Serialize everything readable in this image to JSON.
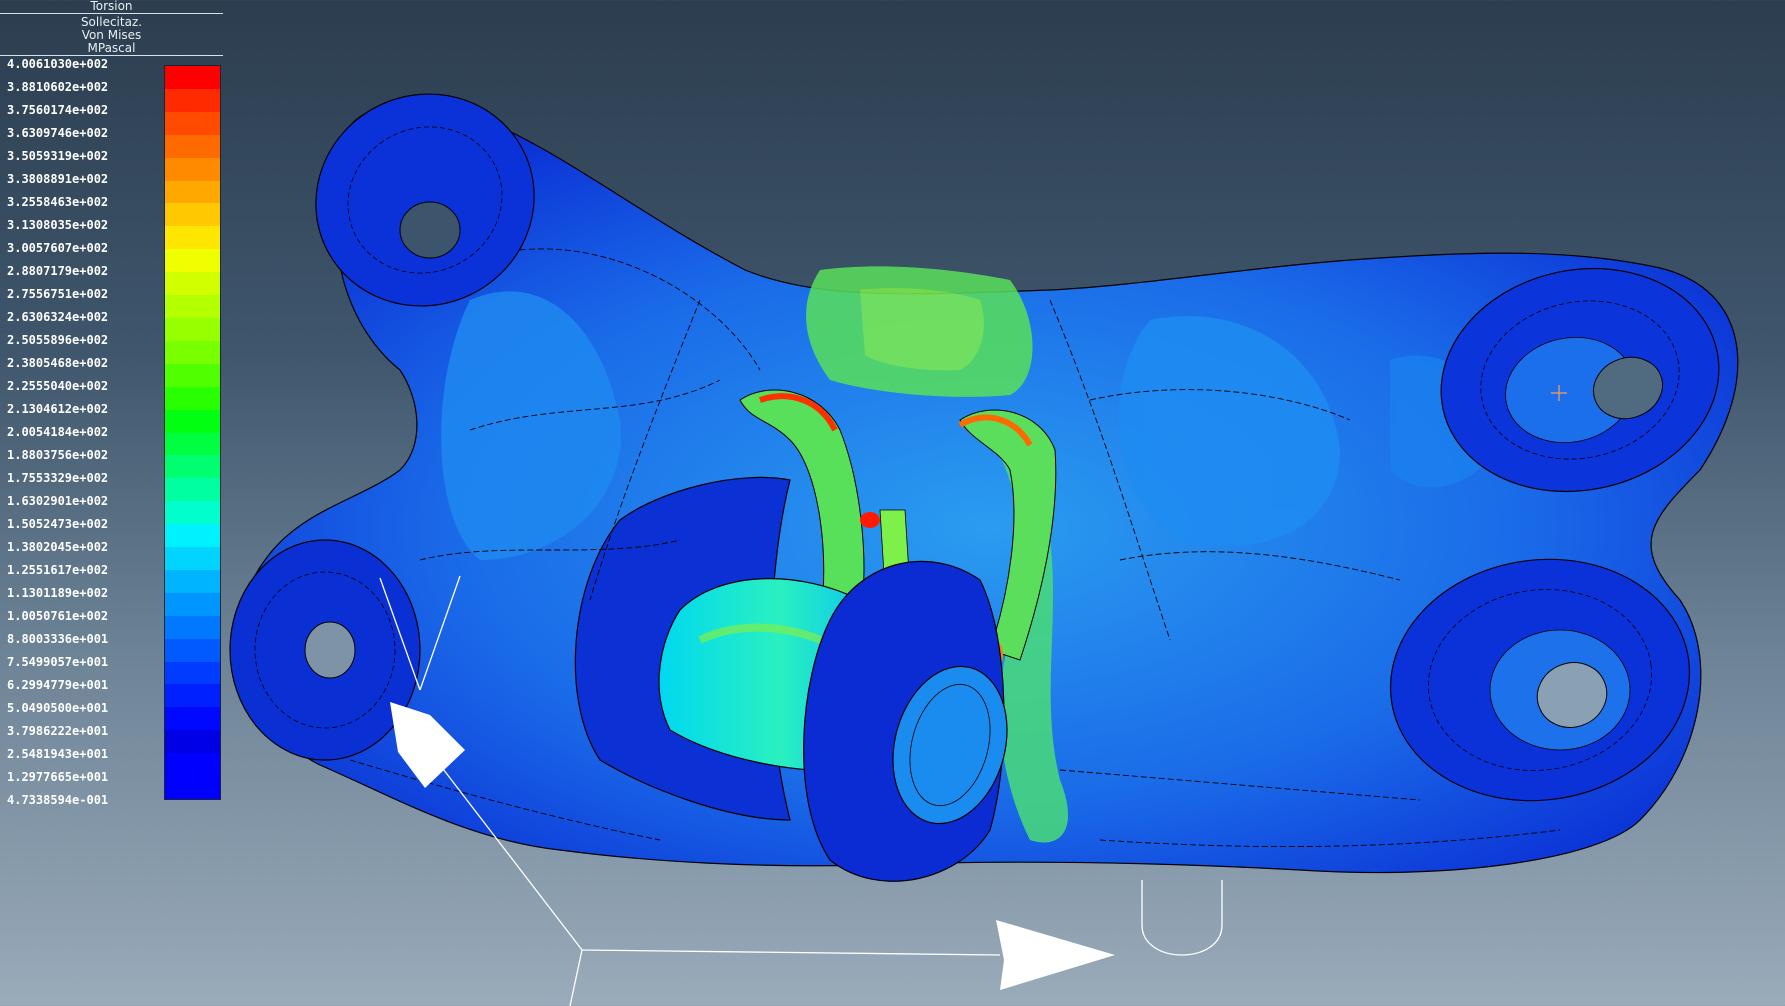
{
  "legend": {
    "case_name": "Torsion",
    "quantity": "Sollecitaz.",
    "criterion": "Von Mises",
    "unit": "MPascal",
    "values": [
      "4.0061030e+002",
      "3.8810602e+002",
      "3.7560174e+002",
      "3.6309746e+002",
      "3.5059319e+002",
      "3.3808891e+002",
      "3.2558463e+002",
      "3.1308035e+002",
      "3.0057607e+002",
      "2.8807179e+002",
      "2.7556751e+002",
      "2.6306324e+002",
      "2.5055896e+002",
      "2.3805468e+002",
      "2.2555040e+002",
      "2.1304612e+002",
      "2.0054184e+002",
      "1.8803756e+002",
      "1.7553329e+002",
      "1.6302901e+002",
      "1.5052473e+002",
      "1.3802045e+002",
      "1.2551617e+002",
      "1.1301189e+002",
      "1.0050761e+002",
      "8.8003336e+001",
      "7.5499057e+001",
      "6.2994779e+001",
      "5.0490500e+001",
      "3.7986222e+001",
      "2.5481943e+001",
      "1.2977665e+001",
      "4.7338594e-001"
    ],
    "colors": [
      "#ff0000",
      "#ff2a00",
      "#ff4a00",
      "#ff6a00",
      "#ff8a00",
      "#ffa800",
      "#ffc800",
      "#ffe600",
      "#f0ff00",
      "#d2ff00",
      "#b4ff00",
      "#96ff00",
      "#78ff00",
      "#50ff00",
      "#28ff00",
      "#00ff10",
      "#00ff40",
      "#00ff70",
      "#00ffa0",
      "#00ffcc",
      "#00f2ff",
      "#00d4ff",
      "#00b4ff",
      "#0096ff",
      "#0078ff",
      "#005aff",
      "#003cff",
      "#0020ff",
      "#0008ff",
      "#0000e6",
      "#0000ff",
      "#0000ff"
    ]
  },
  "scene": {
    "colors": {
      "background_top": "#2c3d4f",
      "background_bottom": "#9aabba",
      "mesh_edge": "#000000",
      "low_stress": "#0a3cd8",
      "mid_stress": "#00e0ff",
      "high_stress": "#ff2000"
    },
    "icons": [
      "load-arrow-icon",
      "constraint-arrow-icon",
      "cursor-crosshair-icon"
    ]
  }
}
